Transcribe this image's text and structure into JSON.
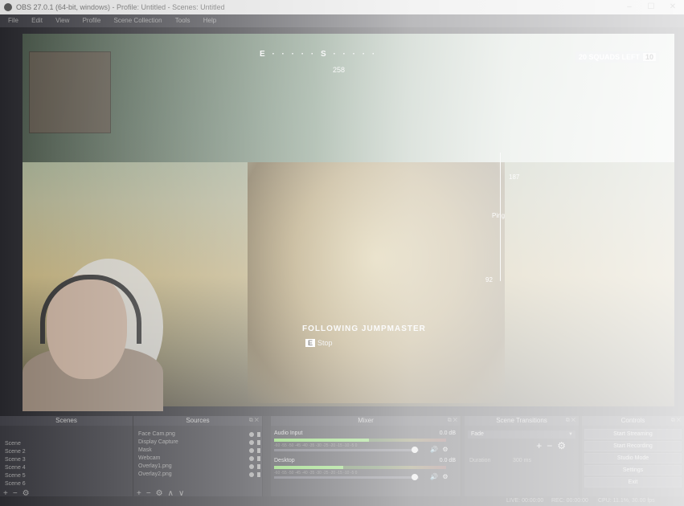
{
  "window": {
    "title": "OBS 27.0.1 (64-bit, windows) - Profile: Untitled - Scenes: Untitled",
    "controls": [
      "–",
      "☐",
      "✕"
    ]
  },
  "menu": [
    "File",
    "Edit",
    "View",
    "Profile",
    "Scene Collection",
    "Tools",
    "Help"
  ],
  "game": {
    "compass": "E  ·  ·  ·  ·  ·  S  ·  ·  ·  ·  ·",
    "compass_degrees": "258",
    "squads_left": "20 SQUADS LEFT",
    "kills": "10",
    "ping_top": "187",
    "ping_mid": "Ping",
    "ping_bottom": "92",
    "center_title": "FOLLOWING JUMPMASTER",
    "center_key": "E",
    "center_sub": "Stop"
  },
  "docks": {
    "scenes": {
      "header": "Scenes",
      "items": [
        "Scene",
        "Scene 2",
        "Scene 3",
        "Scene 4",
        "Scene 5",
        "Scene 6"
      ]
    },
    "sources": {
      "header": "Sources",
      "items": [
        "Face Cam.png",
        "Display Capture",
        "Mask",
        "Webcam",
        "Overlay1.png",
        "Overlay2.png"
      ]
    },
    "mixer": {
      "header": "Mixer",
      "tracks": [
        {
          "name": "Audio Input",
          "db": "0.0 dB",
          "level": 0.55,
          "volume": 0.97
        },
        {
          "name": "Desktop",
          "db": "0.0 dB",
          "level": 0.4,
          "volume": 0.97
        }
      ],
      "ticks": "-60 -55 -50 -45 -40 -35 -30 -25 -20 -15 -10 -5 0"
    },
    "transitions": {
      "header": "Scene Transitions",
      "selected": "Fade",
      "duration_label": "Duration",
      "duration": "300 ms"
    },
    "controls": {
      "header": "Controls",
      "buttons": [
        "Start Streaming",
        "Start Recording",
        "Studio Mode",
        "Settings",
        "Exit"
      ]
    }
  },
  "status": {
    "live": "LIVE: 00:00:00",
    "rec": "REC: 00:00:00",
    "cpu": "CPU: 11.1%, 30.00 fps"
  }
}
